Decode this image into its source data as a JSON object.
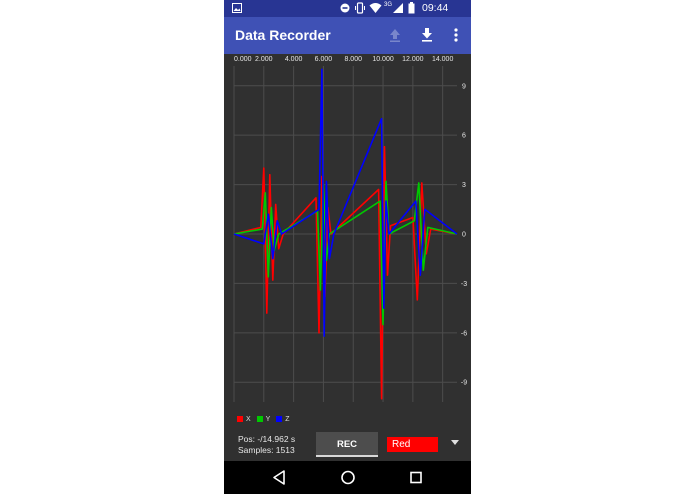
{
  "status_bar": {
    "time": "09:44",
    "signal_label": "3G",
    "icons": [
      "image-icon",
      "dnd-icon",
      "vibrate-icon",
      "wifi-icon",
      "signal-icon",
      "battery-icon"
    ]
  },
  "app_bar": {
    "title": "Data Recorder",
    "actions": [
      "upload-icon",
      "download-icon",
      "more-vert-icon"
    ]
  },
  "plot": {
    "x_ticks": [
      "0.000",
      "2.000",
      "4.000",
      "6.000",
      "8.000",
      "10.000",
      "12.000",
      "14.000"
    ],
    "y_ticks": [
      "9",
      "6",
      "3",
      "0",
      "-3",
      "-6",
      "-9"
    ]
  },
  "chart_data": {
    "type": "line",
    "x_range": [
      0,
      14.962
    ],
    "ylim": [
      -10.2,
      10.2
    ],
    "x_tick_values": [
      0,
      2,
      4,
      6,
      8,
      10,
      12,
      14
    ],
    "y_tick_values": [
      9,
      6,
      3,
      0,
      -3,
      -6,
      -9
    ],
    "grid": true,
    "series": [
      {
        "name": "X",
        "color": "#ff0000",
        "x": [
          0,
          1.8,
          2.0,
          2.2,
          2.4,
          2.6,
          2.8,
          3.0,
          3.3,
          5.5,
          5.7,
          5.9,
          6.1,
          6.3,
          6.5,
          9.7,
          9.9,
          10.1,
          10.3,
          10.5,
          12.0,
          12.3,
          12.6,
          12.9,
          13.2,
          14.962
        ],
        "y": [
          0,
          0.4,
          4.0,
          -4.8,
          3.6,
          -2.8,
          1.8,
          -0.9,
          0,
          2.2,
          -6.0,
          3.5,
          -3.8,
          1.6,
          0,
          2.7,
          -10.0,
          5.3,
          -2.5,
          0.5,
          1.0,
          -4.0,
          3.1,
          -1.2,
          0.3,
          0
        ]
      },
      {
        "name": "Y",
        "color": "#00c800",
        "x": [
          0,
          1.9,
          2.1,
          2.3,
          2.5,
          2.7,
          3.0,
          5.6,
          5.8,
          6.0,
          6.2,
          6.4,
          9.8,
          10.0,
          10.2,
          10.4,
          12.1,
          12.4,
          12.7,
          13.0,
          14.962
        ],
        "y": [
          0,
          0.3,
          2.5,
          -2.6,
          1.6,
          -1.0,
          0,
          1.4,
          -3.4,
          3.0,
          -1.6,
          0,
          2.0,
          -5.5,
          3.2,
          0,
          0.8,
          3.1,
          -2.2,
          0.4,
          0
        ]
      },
      {
        "name": "Z",
        "color": "#0000ff",
        "x": [
          0,
          2.0,
          2.3,
          2.6,
          2.9,
          3.2,
          5.7,
          5.9,
          6.05,
          6.2,
          6.4,
          6.7,
          9.9,
          10.05,
          10.2,
          10.4,
          12.2,
          12.5,
          12.8,
          14.962
        ],
        "y": [
          0,
          -0.6,
          1.2,
          -1.5,
          0.8,
          0,
          1.5,
          10.0,
          -6.2,
          3.2,
          -1.5,
          0,
          7.0,
          -4.5,
          2.0,
          0,
          2.0,
          -2.5,
          1.5,
          0
        ]
      }
    ]
  },
  "legend": {
    "items": [
      {
        "label": "X",
        "color": "#ff0000"
      },
      {
        "label": "Y",
        "color": "#00c800"
      },
      {
        "label": "Z",
        "color": "#0000ff"
      }
    ]
  },
  "info": {
    "pos": "Pos: -/14.962 s",
    "samples": "Samples: 1513"
  },
  "controls": {
    "rec_label": "REC",
    "color_value": "Red"
  },
  "nav_bar": {
    "buttons": [
      "back-icon",
      "home-icon",
      "recents-icon"
    ]
  }
}
